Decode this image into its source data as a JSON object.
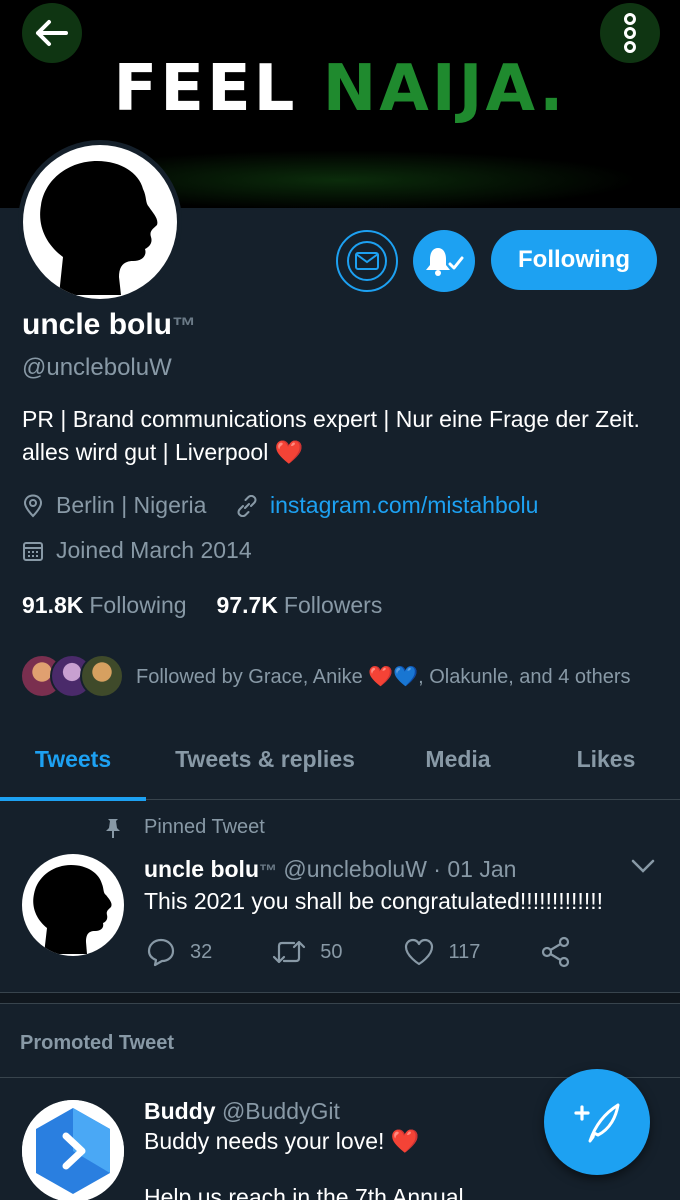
{
  "banner": {
    "word1": "FEEL",
    "word2": "NAIJA."
  },
  "profile": {
    "name": "uncle bolu",
    "tm": "™",
    "handle": "@uncleboluW",
    "bio_text": "PR | Brand communications expert | Nur eine Frage der Zeit. alles wird gut | Liverpool",
    "bio_emoji": "❤️",
    "location": "Berlin | Nigeria",
    "link": "instagram.com/mistahbolu",
    "joined": "Joined March 2014",
    "following_count": "91.8K",
    "following_label": "Following",
    "followers_count": "97.7K",
    "followers_label": "Followers",
    "followed_by": "Followed by Grace⁦, Anike ❤️💙, Olakunle, and 4 others"
  },
  "actions": {
    "follow_button": "Following"
  },
  "tabs": [
    "Tweets",
    "Tweets & replies",
    "Media",
    "Likes"
  ],
  "pinned": {
    "label": "Pinned Tweet",
    "author": "uncle bolu",
    "tm": "™",
    "meta": " @uncleboluW · 01 Jan",
    "text": "This 2021 you shall be congratulated!!!!!!!!!!!!!",
    "replies": "32",
    "retweets": "50",
    "likes": "117"
  },
  "promoted": {
    "label": "Promoted Tweet",
    "author": "Buddy",
    "meta": " @BuddyGit",
    "text": "Buddy needs your love! ❤️",
    "text2": "Help us reach in the 7th Annual"
  },
  "colors": {
    "accent": "#1da1f2",
    "background": "#15202b",
    "banner_green": "#1f8a2e"
  },
  "icons": [
    "back-arrow-icon",
    "more-vertical-icon",
    "mail-icon",
    "bell-check-icon",
    "location-icon",
    "link-icon",
    "calendar-icon",
    "pin-icon",
    "reply-icon",
    "retweet-icon",
    "like-icon",
    "share-icon",
    "chevron-down-icon",
    "compose-icon"
  ]
}
